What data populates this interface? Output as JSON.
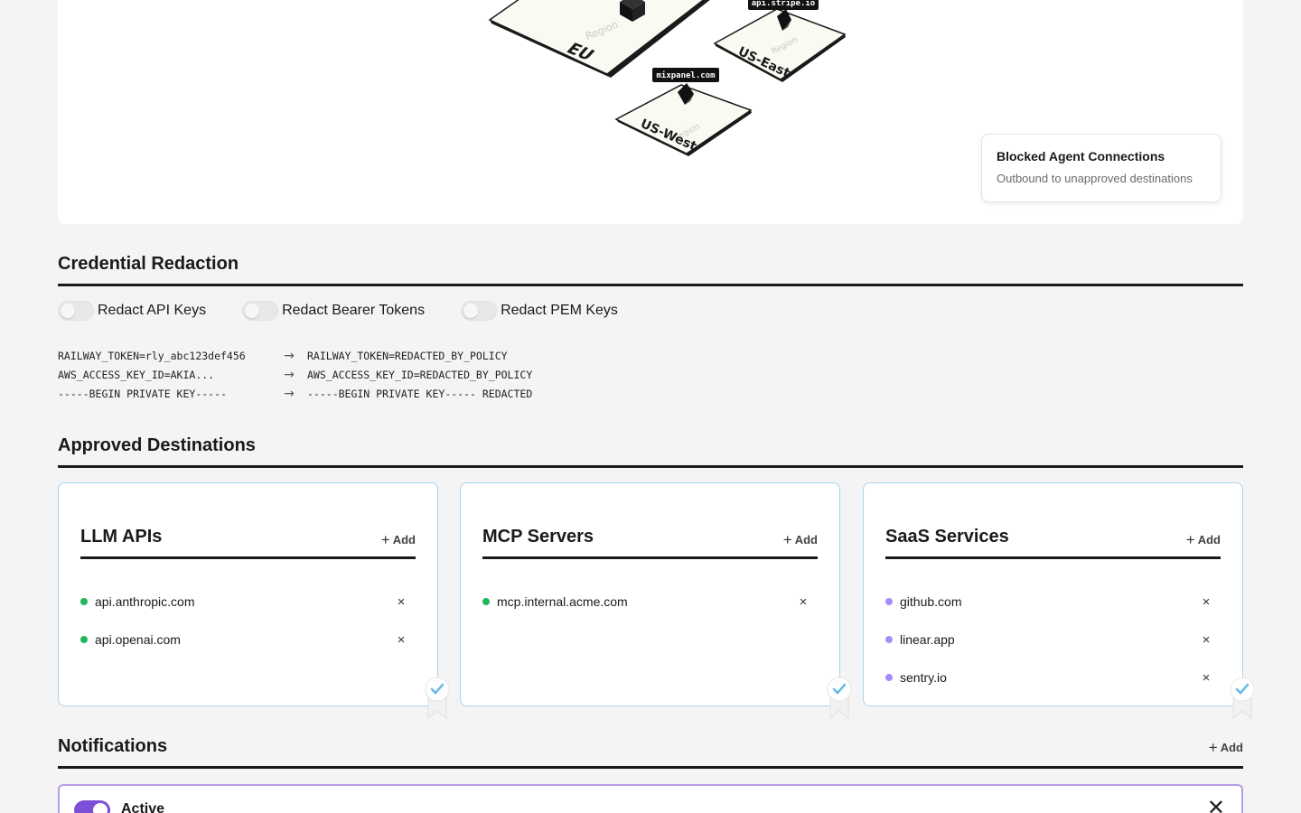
{
  "map": {
    "regions": [
      {
        "tag": "Region",
        "name": "EU"
      },
      {
        "tag": "Region",
        "name": "US-East"
      },
      {
        "tag": "Region",
        "name": "US-West"
      }
    ],
    "destinations": [
      "api.stripe.io",
      "mixpanel.com"
    ],
    "blocked": {
      "title": "Blocked Agent Connections",
      "subtitle": "Outbound to unapproved destinations"
    }
  },
  "credential_redaction": {
    "title": "Credential Redaction",
    "toggles": [
      {
        "label": "Redact API Keys",
        "on": false
      },
      {
        "label": "Redact Bearer Tokens",
        "on": false
      },
      {
        "label": "Redact PEM Keys",
        "on": false
      }
    ],
    "examples": [
      {
        "before": "RAILWAY_TOKEN=rly_abc123def456",
        "arrow": "→",
        "after": "RAILWAY_TOKEN=REDACTED_BY_POLICY"
      },
      {
        "before": "AWS_ACCESS_KEY_ID=AKIA...",
        "arrow": "→",
        "after": "AWS_ACCESS_KEY_ID=REDACTED_BY_POLICY"
      },
      {
        "before": "-----BEGIN PRIVATE KEY-----",
        "arrow": "→",
        "after": "-----BEGIN PRIVATE KEY----- REDACTED"
      }
    ]
  },
  "approved_destinations": {
    "title": "Approved Destinations",
    "groups": [
      {
        "title": "LLM APIs",
        "add_label": "Add",
        "dot_color": "#22b55a",
        "items": [
          "api.anthropic.com",
          "api.openai.com"
        ]
      },
      {
        "title": "MCP Servers",
        "add_label": "Add",
        "dot_color": "#22b55a",
        "items": [
          "mcp.internal.acme.com"
        ]
      },
      {
        "title": "SaaS Services",
        "add_label": "Add",
        "dot_color": "#a78bfa",
        "items": [
          "github.com",
          "linear.app",
          "sentry.io"
        ]
      }
    ],
    "remove_glyph": "×",
    "badge_icon": "verified-ribbon-icon"
  },
  "notifications": {
    "title": "Notifications",
    "add_label": "Add",
    "items": [
      {
        "label": "Active",
        "on": true
      }
    ],
    "close_glyph": "✕"
  },
  "colors": {
    "accent_purple": "#7b4fd6",
    "card_border_blue": "#a9d3ee",
    "badge_blue": "#6ab8ea",
    "active_green": "#22b55a",
    "saas_purple": "#a78bfa"
  }
}
